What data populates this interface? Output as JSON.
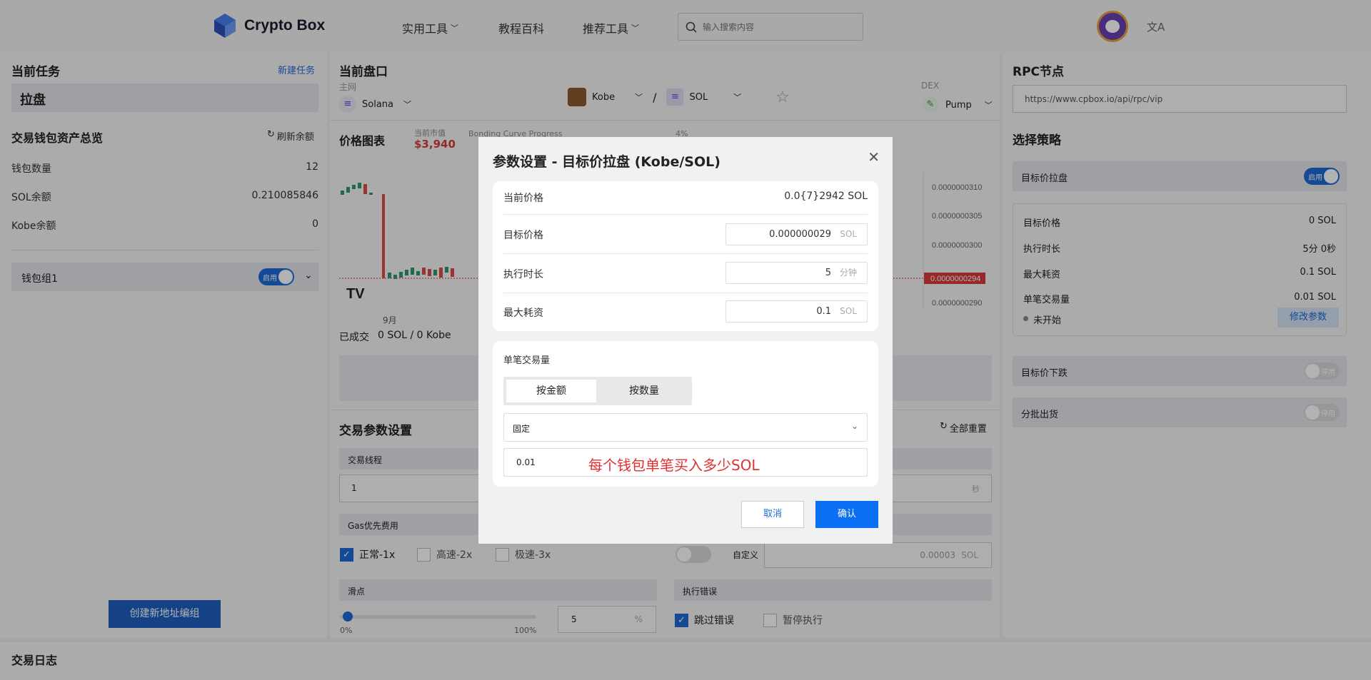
{
  "header": {
    "logo_text": "Crypto Box",
    "nav": [
      "实用工具",
      "教程百科",
      "推荐工具"
    ],
    "search_placeholder": "输入搜索内容",
    "lang_icon": "文A"
  },
  "left": {
    "task_title": "当前任务",
    "new_task": "新建任务",
    "task_name": "拉盘",
    "assets_title": "交易钱包资产总览",
    "refresh": "刷新余额",
    "rows": [
      {
        "label": "钱包数量",
        "value": "12"
      },
      {
        "label": "SOL余额",
        "value": "0.210085846"
      },
      {
        "label": "Kobe余额",
        "value": "0"
      }
    ],
    "group_name": "钱包组1",
    "toggle_on": "启用",
    "create_group": "创建新地址编组",
    "log_title": "交易日志"
  },
  "middle": {
    "title": "当前盘口",
    "mainnet_label": "主网",
    "chain": "Solana",
    "token_a": "Kobe",
    "slash": "/",
    "token_b": "SOL",
    "dex_label": "DEX",
    "dex": "Pump",
    "chart_title": "价格图表",
    "mcap_label": "当前市值",
    "mcap": "$3,940",
    "curve_label": "Bonding Curve Progress",
    "curve_pct": "4%",
    "price_ticks": [
      "0.0000000310",
      "0.0000000305",
      "0.0000000300",
      "0.0000000294",
      "0.0000000290"
    ],
    "month": "9月",
    "deal_label": "已成交",
    "deal_value": "0 SOL / 0 Kobe",
    "params_title": "交易参数设置",
    "reset_all": "全部重置",
    "thread_label": "交易线程",
    "thread_value": "1",
    "sec_unit": "秒",
    "gas_label": "Gas优先费用",
    "gas_options": [
      "正常-1x",
      "高速-2x",
      "极速-3x"
    ],
    "custom_label": "自定义",
    "custom_value": "0.00003",
    "custom_unit": "SOL",
    "slippage_label": "滑点",
    "slip_min": "0%",
    "slip_max": "100%",
    "slip_value": "5",
    "slip_unit": "%",
    "err_label": "执行错误",
    "err_options": [
      "跳过错误",
      "暂停执行"
    ],
    "toggle_off": "启用"
  },
  "right": {
    "rpc_title": "RPC节点",
    "rpc_url": "https://www.cpbox.io/api/rpc/vip",
    "strategy_title": "选择策略",
    "strategy_1": "目标价拉盘",
    "toggle_on": "启用",
    "rows": [
      {
        "label": "目标价格",
        "value": "0 SOL"
      },
      {
        "label": "执行时长",
        "value": "5分 0秒"
      },
      {
        "label": "最大耗资",
        "value": "0.1 SOL"
      },
      {
        "label": "单笔交易量",
        "value": "0.01 SOL"
      }
    ],
    "status": "未开始",
    "modify": "修改参数",
    "strategy_2": "目标价下跌",
    "strategy_3": "分批出货",
    "toggle_off": "停用"
  },
  "modal": {
    "title": "参数设置 - 目标价拉盘 (Kobe/SOL)",
    "current_price_label": "当前价格",
    "current_price": "0.0{7}2942 SOL",
    "target_label": "目标价格",
    "target_value": "0.000000029",
    "target_unit": "SOL",
    "duration_label": "执行时长",
    "duration_value": "5",
    "duration_unit": "分钟",
    "max_label": "最大耗资",
    "max_value": "0.1",
    "max_unit": "SOL",
    "single_label": "单笔交易量",
    "tab_amount": "按金额",
    "tab_qty": "按数量",
    "mode_value": "固定",
    "amount_value": "0.01",
    "annotation": "每个钱包单笔买入多少SOL",
    "cancel": "取消",
    "confirm": "确认"
  }
}
